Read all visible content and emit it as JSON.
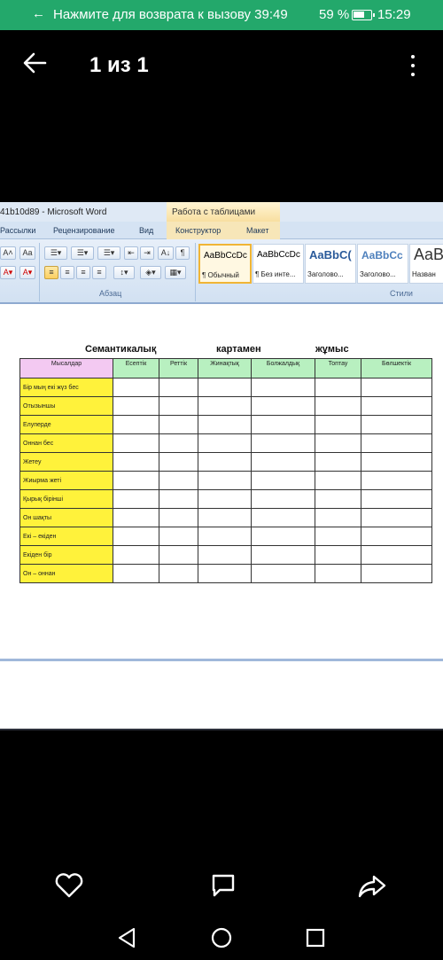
{
  "status_bar": {
    "back_arrow": "←",
    "call_text": "Нажмите для возврата к вызову 39:49",
    "battery_pct": "59 %",
    "time": "15:29"
  },
  "viewer": {
    "counter": "1 из 1",
    "back_icon": "arrow-left-icon",
    "menu_icon": "more-vert-icon",
    "actions": [
      "heart-icon",
      "comment-icon",
      "share-icon"
    ]
  },
  "word": {
    "doc_name": "41b10d89 - Microsoft Word",
    "context_tab": "Работа с таблицами",
    "tabs": [
      "Рассылки",
      "Рецензирование",
      "Вид",
      "Конструктор",
      "Макет"
    ],
    "groups": {
      "paragraph": "Абзац",
      "styles": "Стили"
    },
    "styles": [
      {
        "sample": "AaBbCcDc",
        "name": "¶ Обычный"
      },
      {
        "sample": "AaBbCcDc",
        "name": "¶ Без инте..."
      },
      {
        "sample": "AaBbC(",
        "name": "Заголово..."
      },
      {
        "sample": "AaBbCc",
        "name": "Заголово..."
      },
      {
        "sample": "AaB",
        "name": "Назван"
      }
    ]
  },
  "worksheet": {
    "heading": [
      "Семантикалық",
      "картамен",
      "жұмыс"
    ],
    "columns": [
      "Мысалдар",
      "Есептік",
      "Реттік",
      "Жинақтық",
      "Болжалдық",
      "Топтау",
      "Бөлшектік"
    ],
    "rows": [
      "Бір мың екі жүз бес",
      "Отызыншы",
      "Елуперде",
      "Оннан бес",
      "Жетеу",
      "Жиырма жеті",
      "Қырық бірінші",
      "Он шақты",
      "Екі – екіден",
      "Екіден бір",
      "Он – оннан"
    ]
  },
  "colors": {
    "status_bar": "#23a86b",
    "header_first": "#f3c9f2",
    "header_other": "#b8f0c0",
    "row_label": "#fff23b"
  }
}
